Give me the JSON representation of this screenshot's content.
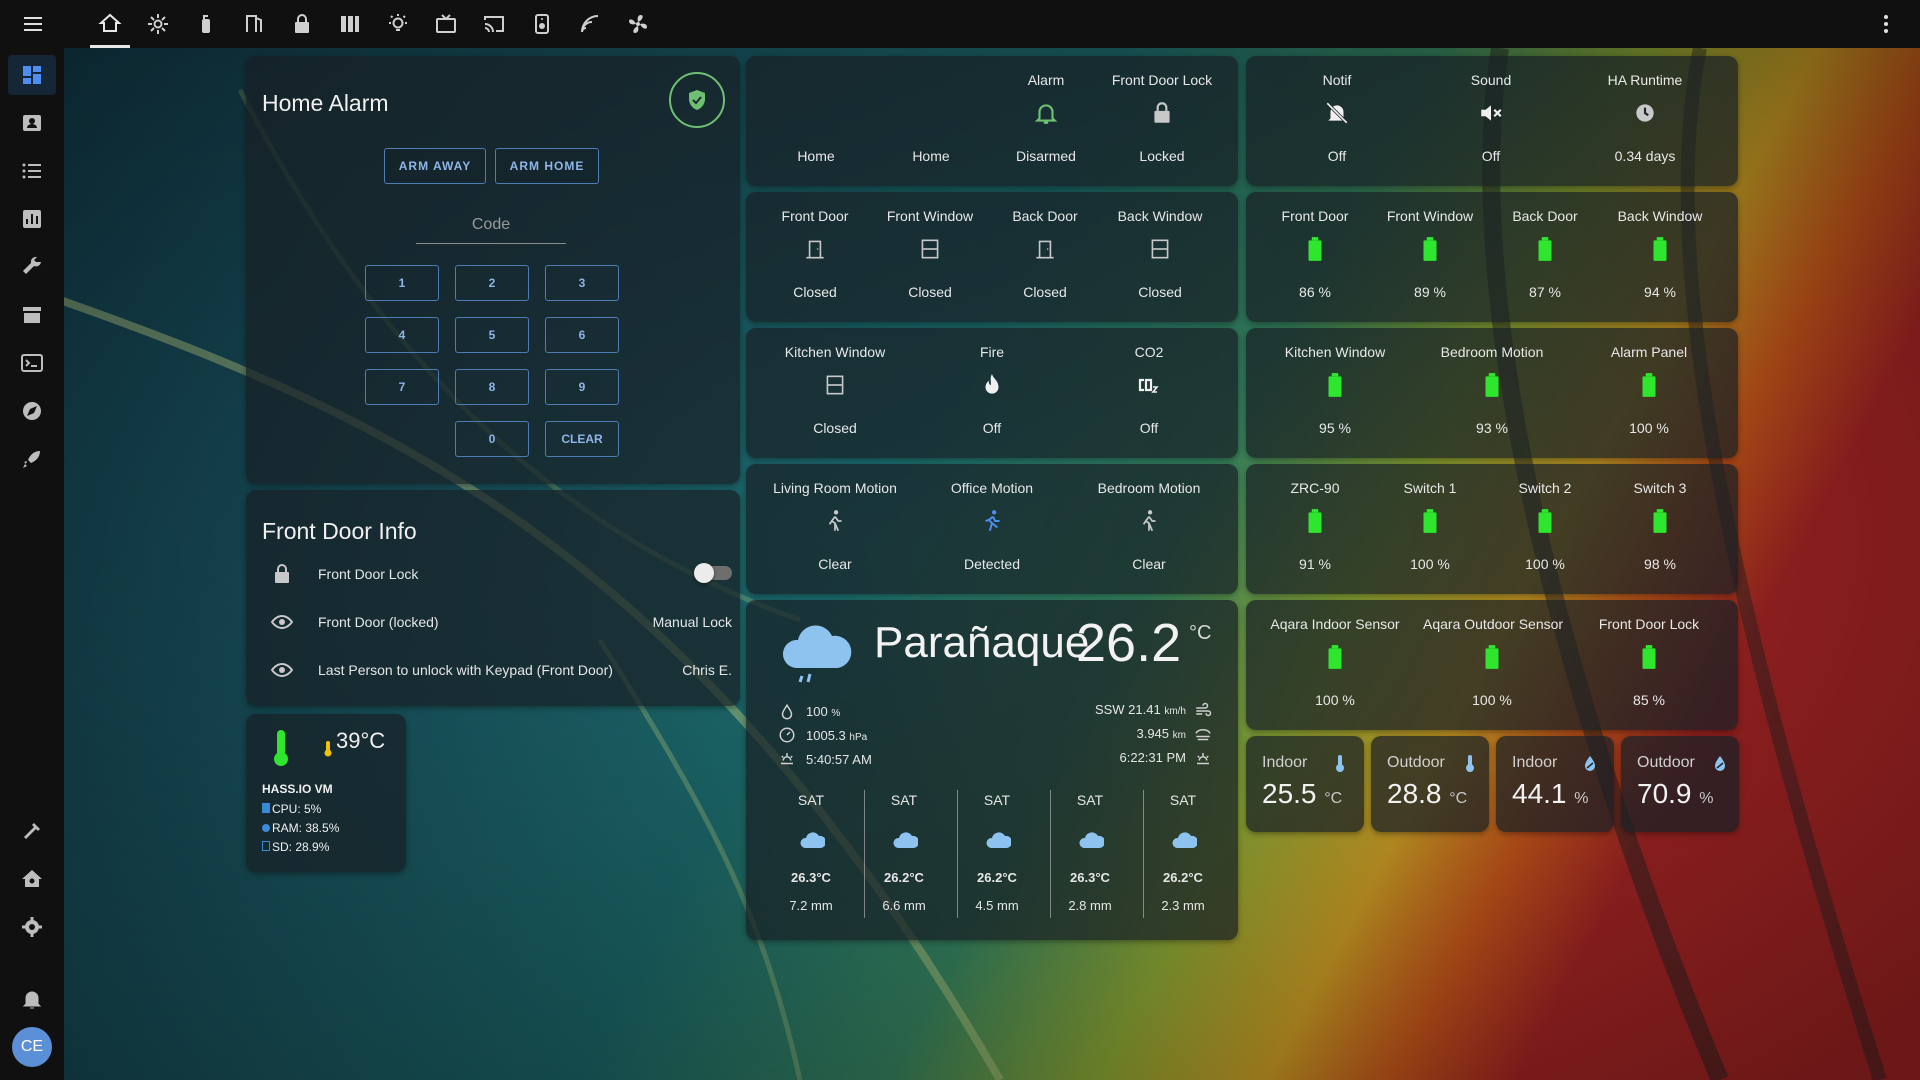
{
  "colors": {
    "accent": "#8fb5e8",
    "battery_green": "#2ee62e",
    "alarm_green": "#6fbf73",
    "motion_detected": "#4f8ef0",
    "card_bg": "rgba(24,32,38,0.72)"
  },
  "topbar": {
    "menu_icon": "menu-icon",
    "views": [
      "home-icon",
      "settings-icon",
      "fire-extinguisher-icon",
      "door-icon",
      "lock-icon",
      "bar-gauge-icon",
      "lightbulb-icon",
      "tv-icon",
      "cast-icon",
      "speaker-icon",
      "signal-icon",
      "fan-icon"
    ],
    "overflow_icon": "dots-vertical-icon"
  },
  "sidebar": {
    "items": [
      "dashboard-icon",
      "map-icon",
      "logbook-icon",
      "history-icon",
      "wrench-icon",
      "store-icon",
      "terminal-icon",
      "compass-icon",
      "rocket-icon",
      "hammer-icon",
      "house-config-icon",
      "cog-icon",
      "bell-icon"
    ],
    "user_initials": "CE"
  },
  "alarm": {
    "title": "Home Alarm",
    "arm_away": "ARM AWAY",
    "arm_home": "ARM HOME",
    "code_label": "Code",
    "keys": [
      "1",
      "2",
      "3",
      "4",
      "5",
      "6",
      "7",
      "8",
      "9",
      "0",
      "CLEAR"
    ]
  },
  "status_row": {
    "items": [
      {
        "name": "",
        "state": "Home",
        "icon": "user-icon"
      },
      {
        "name": "",
        "state": "Home",
        "icon": "user-icon"
      },
      {
        "name": "Alarm",
        "state": "Disarmed",
        "icon": "bell-outline-icon"
      },
      {
        "name": "Front Door Lock",
        "state": "Locked",
        "icon": "lock-icon"
      }
    ]
  },
  "notif_row": {
    "items": [
      {
        "name": "Notif",
        "state": "Off",
        "icon": "bell-off-icon"
      },
      {
        "name": "Sound",
        "state": "Off",
        "icon": "volume-off-icon"
      },
      {
        "name": "HA Runtime",
        "state": "0.34 days",
        "icon": "clock-icon"
      }
    ]
  },
  "doors_row": {
    "items": [
      {
        "name": "Front Door",
        "state": "Closed",
        "icon": "door-closed-icon"
      },
      {
        "name": "Front Window",
        "state": "Closed",
        "icon": "window-closed-icon"
      },
      {
        "name": "Back Door",
        "state": "Closed",
        "icon": "door-closed-icon"
      },
      {
        "name": "Back Window",
        "state": "Closed",
        "icon": "window-closed-icon"
      }
    ]
  },
  "battery_row1": {
    "items": [
      {
        "name": "Front Door",
        "state": "86 %"
      },
      {
        "name": "Front Window",
        "state": "89 %"
      },
      {
        "name": "Back Door",
        "state": "87 %"
      },
      {
        "name": "Back Window",
        "state": "94 %"
      }
    ]
  },
  "kitchen_row": {
    "items": [
      {
        "name": "Kitchen Window",
        "state": "Closed",
        "icon": "window-closed-icon"
      },
      {
        "name": "Fire",
        "state": "Off",
        "icon": "fire-icon"
      },
      {
        "name": "CO2",
        "state": "Off",
        "icon": "molecule-co2-icon"
      }
    ]
  },
  "battery_row2": {
    "items": [
      {
        "name": "Kitchen Window",
        "state": "95 %"
      },
      {
        "name": "Bedroom Motion",
        "state": "93 %"
      },
      {
        "name": "Alarm Panel",
        "state": "100 %"
      }
    ]
  },
  "motion_row": {
    "items": [
      {
        "name": "Living Room Motion",
        "state": "Clear",
        "icon": "walk-icon"
      },
      {
        "name": "Office Motion",
        "state": "Detected",
        "icon": "run-icon"
      },
      {
        "name": "Bedroom Motion",
        "state": "Clear",
        "icon": "walk-icon"
      }
    ]
  },
  "battery_row3": {
    "items": [
      {
        "name": "ZRC-90",
        "state": "91 %"
      },
      {
        "name": "Switch 1",
        "state": "100 %"
      },
      {
        "name": "Switch 2",
        "state": "100 %"
      },
      {
        "name": "Switch 3",
        "state": "98 %"
      }
    ]
  },
  "battery_row4": {
    "items": [
      {
        "name": "Aqara Indoor Sensor",
        "state": "100 %"
      },
      {
        "name": "Aqara Outdoor Sensor",
        "state": "100 %"
      },
      {
        "name": "Front Door Lock",
        "state": "85 %"
      }
    ]
  },
  "front_door_info": {
    "title": "Front Door Info",
    "rows": [
      {
        "label": "Front Door Lock",
        "icon": "lock-icon",
        "toggle_on": false
      },
      {
        "label": "Front Door (locked)",
        "icon": "eye-icon",
        "value": "Manual Lock"
      },
      {
        "label": "Last Person to unlock with Keypad (Front Door)",
        "icon": "eye-icon",
        "value": "Chris E."
      }
    ]
  },
  "system": {
    "icon": "thermometer-icon",
    "temp": "39°C",
    "host": "HASS.IO VM",
    "cpu": "CPU: 5%",
    "ram": "RAM: 38.5%",
    "sd": "SD: 28.9%"
  },
  "weather": {
    "city": "Parañaque",
    "temp": "26.2",
    "unit": "°C",
    "icon": "rainy-cloud-icon",
    "humidity": "100",
    "humidity_unit": "%",
    "pressure": "1005.3",
    "pressure_unit": "hPa",
    "sunrise": "5:40:57 AM",
    "wind": "SSW 21.41",
    "wind_unit": "km/h",
    "visibility": "3.945",
    "visibility_unit": "km",
    "sunset": "6:22:31 PM",
    "forecast": [
      {
        "day": "SAT",
        "temp": "26.3°C",
        "precip": "7.2 mm"
      },
      {
        "day": "SAT",
        "temp": "26.2°C",
        "precip": "6.6 mm"
      },
      {
        "day": "SAT",
        "temp": "26.2°C",
        "precip": "4.5 mm"
      },
      {
        "day": "SAT",
        "temp": "26.3°C",
        "precip": "2.8 mm"
      },
      {
        "day": "SAT",
        "temp": "26.2°C",
        "precip": "2.3 mm"
      }
    ]
  },
  "mini_sensors": [
    {
      "name": "Indoor",
      "value": "25.5",
      "unit": "°C",
      "icon": "thermometer-icon"
    },
    {
      "name": "Outdoor",
      "value": "28.8",
      "unit": "°C",
      "icon": "thermometer-icon"
    },
    {
      "name": "Indoor",
      "value": "44.1",
      "unit": "%",
      "icon": "water-percent-icon"
    },
    {
      "name": "Outdoor",
      "value": "70.9",
      "unit": "%",
      "icon": "water-percent-icon"
    }
  ]
}
